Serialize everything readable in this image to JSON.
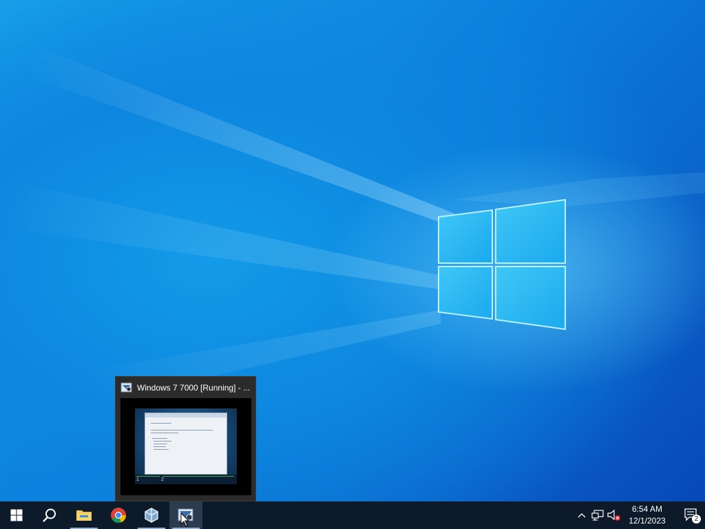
{
  "thumbnail": {
    "title": "Windows 7 7000 [Running] - ...",
    "preview_task_numbers": [
      "1",
      "2"
    ]
  },
  "taskbar": {
    "items": [
      {
        "icon": "windows-start-icon"
      },
      {
        "icon": "search-icon"
      },
      {
        "icon": "file-explorer-icon"
      },
      {
        "icon": "chrome-icon"
      },
      {
        "icon": "virtualbox-icon"
      },
      {
        "icon": "virtualbox-vm-icon"
      }
    ]
  },
  "tray": {
    "time": "6:54 AM",
    "date": "12/1/2023",
    "notification_count": "2"
  },
  "colors": {
    "taskbar": "#0c1a2a",
    "active_underline": "#8fb3d6",
    "wallpaper_blue": "#0a63c9"
  }
}
